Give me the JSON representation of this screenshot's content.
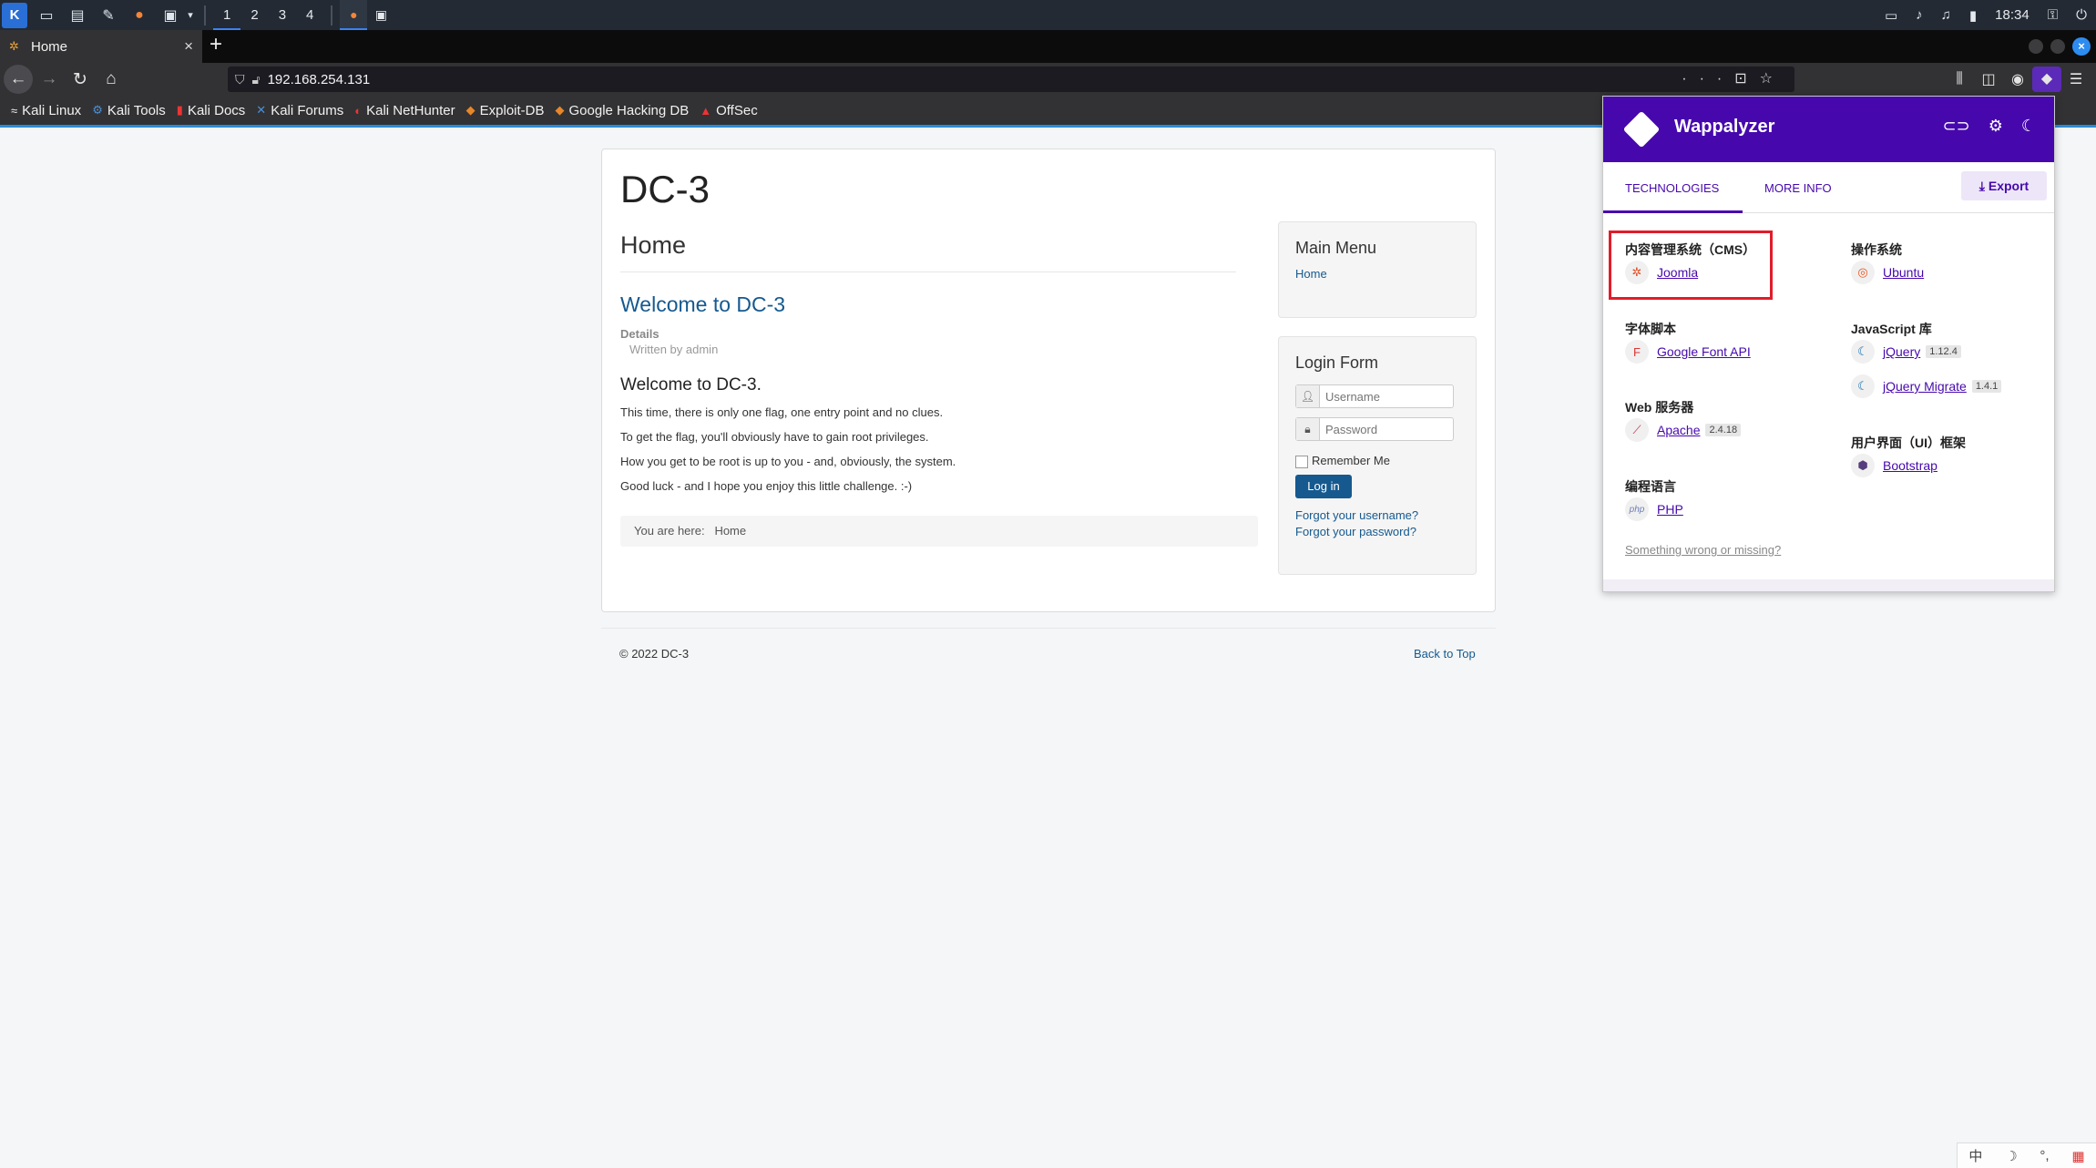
{
  "taskbar": {
    "workspaces": [
      "1",
      "2",
      "3",
      "4"
    ],
    "clock": "18:34"
  },
  "browser": {
    "tab_title": "Home",
    "tab_close": "×",
    "new_tab": "+",
    "url": "192.168.254.131",
    "bookmarks": [
      "Kali Linux",
      "Kali Tools",
      "Kali Docs",
      "Kali Forums",
      "Kali NetHunter",
      "Exploit-DB",
      "Google Hacking DB",
      "OffSec"
    ]
  },
  "site": {
    "title": "DC-3",
    "page_heading": "Home",
    "article_title": "Welcome to DC-3",
    "details_label": "Details",
    "written_by": "Written by admin",
    "article_subheading": "Welcome to DC-3.",
    "paragraphs": [
      "This time, there is only one flag, one entry point and no clues.",
      "To get the flag, you'll obviously have to gain root privileges.",
      "How you get to be root is up to you - and, obviously, the system.",
      "Good luck - and I hope you enjoy this little challenge.  :-)"
    ],
    "breadcrumb_label": "You are here:",
    "breadcrumb_current": "Home",
    "main_menu_title": "Main Menu",
    "main_menu_home": "Home",
    "login_title": "Login Form",
    "username_placeholder": "Username",
    "password_placeholder": "Password",
    "remember_me": "Remember Me",
    "login_button": "Log in",
    "forgot_username": "Forgot your username?",
    "forgot_password": "Forgot your password?",
    "footer_copyright": "© 2022 DC-3",
    "back_to_top": "Back to Top"
  },
  "wappalyzer": {
    "title": "Wappalyzer",
    "tab_technologies": "TECHNOLOGIES",
    "tab_more_info": "MORE INFO",
    "export_label": "Export",
    "categories": {
      "cms": {
        "label": "内容管理系统（CMS）",
        "items": [
          {
            "name": "Joomla",
            "version": ""
          }
        ]
      },
      "os": {
        "label": "操作系统",
        "items": [
          {
            "name": "Ubuntu",
            "version": ""
          }
        ]
      },
      "font": {
        "label": "字体脚本",
        "items": [
          {
            "name": "Google Font API",
            "version": ""
          }
        ]
      },
      "js": {
        "label": "JavaScript 库",
        "items": [
          {
            "name": "jQuery",
            "version": "1.12.4"
          },
          {
            "name": "jQuery Migrate",
            "version": "1.4.1"
          }
        ]
      },
      "web": {
        "label": "Web 服务器",
        "items": [
          {
            "name": "Apache",
            "version": "2.4.18"
          }
        ]
      },
      "ui": {
        "label": "用户界面（UI）框架",
        "items": [
          {
            "name": "Bootstrap",
            "version": ""
          }
        ]
      },
      "lang": {
        "label": "编程语言",
        "items": [
          {
            "name": "PHP",
            "version": ""
          }
        ]
      }
    },
    "missing_link": "Something wrong or missing?"
  },
  "ime": {
    "lang": "中"
  }
}
